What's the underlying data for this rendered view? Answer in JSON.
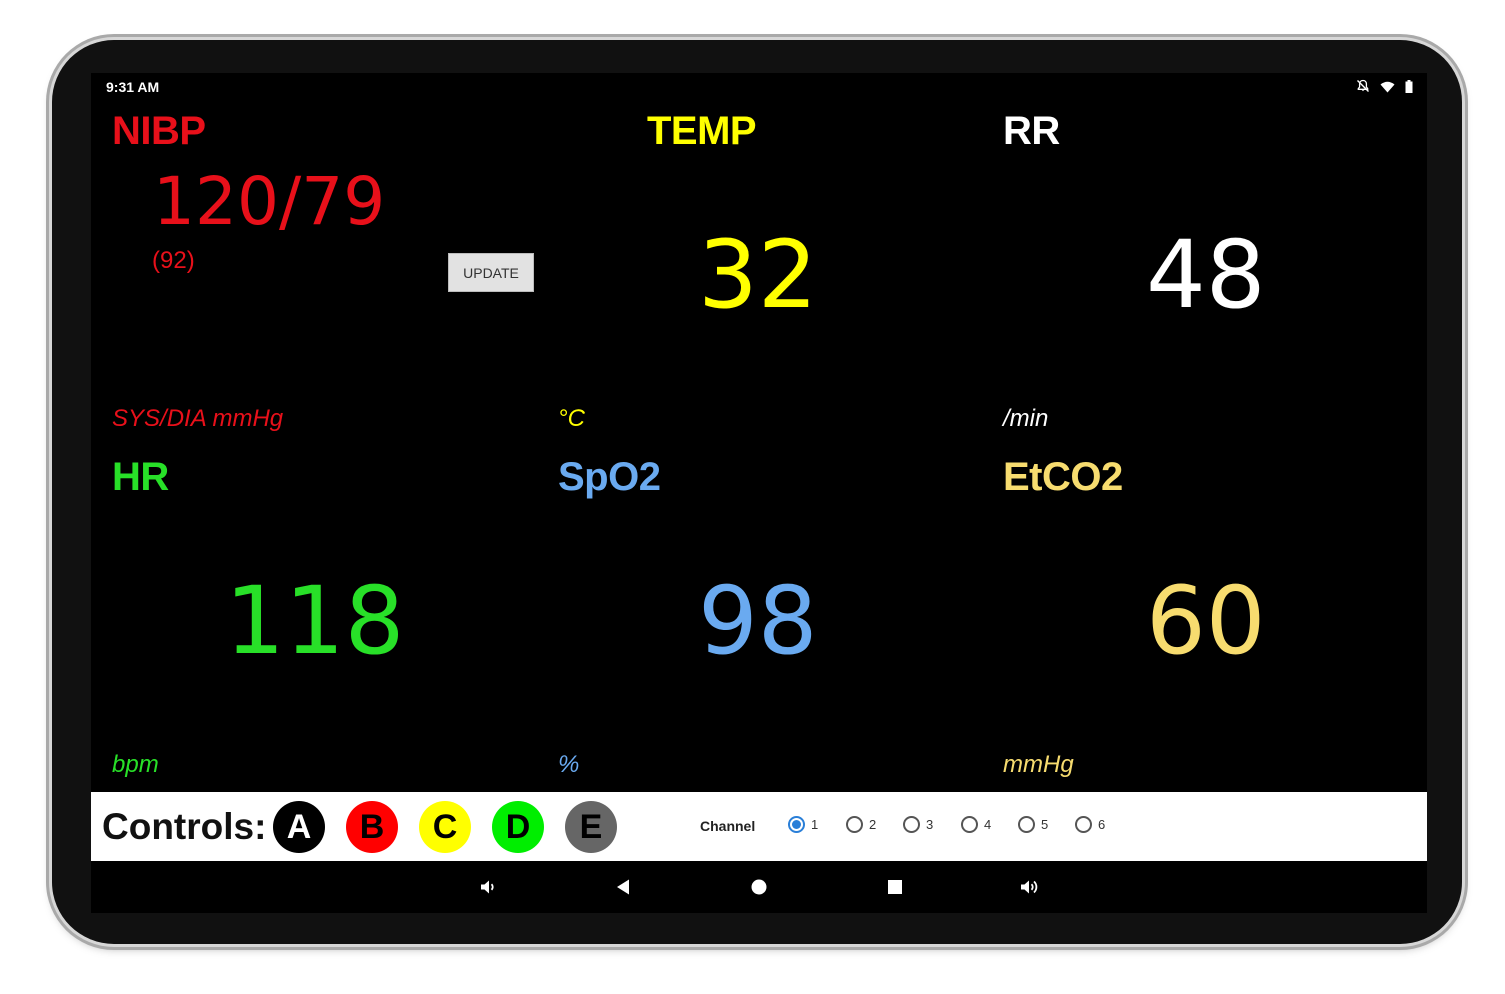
{
  "status_bar": {
    "time": "9:31 AM",
    "icons": [
      "notifications-off-icon",
      "wifi-icon",
      "battery-icon"
    ]
  },
  "tiles": {
    "nibp": {
      "title": "NIBP",
      "value": "120/79",
      "map": "(92)",
      "unit": "SYS/DIA mmHg",
      "color": "#e8101a"
    },
    "temp": {
      "title": "TEMP",
      "value": "32",
      "unit": "°C",
      "color": "#ffff00"
    },
    "rr": {
      "title": "RR",
      "value": "48",
      "unit": "/min",
      "color": "#ffffff"
    },
    "hr": {
      "title": "HR",
      "value": "118",
      "unit": "bpm",
      "color": "#28e028"
    },
    "spo2": {
      "title": "SpO2",
      "value": "98",
      "unit": "%",
      "color": "#6aaaf0"
    },
    "etco2": {
      "title": "EtCO2",
      "value": "60",
      "unit": "mmHg",
      "color": "#f7dc6f"
    }
  },
  "update_button": {
    "label": "UPDATE"
  },
  "controls": {
    "label": "Controls:",
    "buttons": [
      {
        "label": "A",
        "color": "#000000",
        "text_color": "#ffffff"
      },
      {
        "label": "B",
        "color": "#ff0000",
        "text_color": "#000000"
      },
      {
        "label": "C",
        "color": "#ffff00",
        "text_color": "#000000"
      },
      {
        "label": "D",
        "color": "#00ee00",
        "text_color": "#000000"
      },
      {
        "label": "E",
        "color": "#666666",
        "text_color": "#000000"
      }
    ],
    "channel_label": "Channel",
    "channels": [
      "1",
      "2",
      "3",
      "4",
      "5",
      "6"
    ],
    "selected_channel": "1"
  },
  "nav_bar": {
    "icons": [
      "volume-down-icon",
      "back-icon",
      "home-icon",
      "recents-icon",
      "volume-up-icon"
    ]
  }
}
